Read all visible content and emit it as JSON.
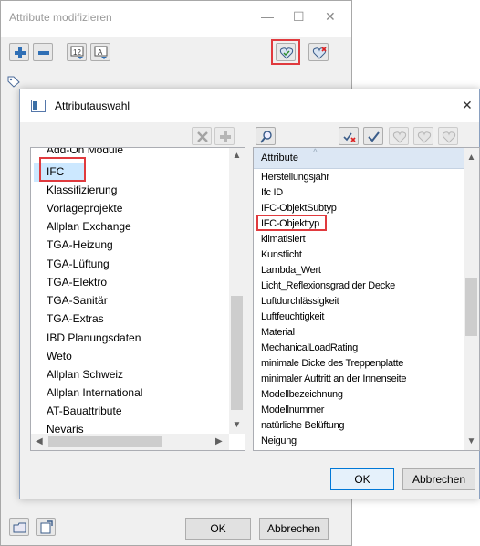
{
  "outer": {
    "title": "Attribute modifizieren",
    "ok": "OK",
    "cancel": "Abbrechen"
  },
  "window_controls": [
    "—",
    "☐",
    "✕"
  ],
  "inner": {
    "title": "Attributauswahl",
    "close": "✕",
    "ok": "OK",
    "cancel": "Abbrechen",
    "column_header": "Attribute"
  },
  "left_list": {
    "items": [
      "Add-On Module",
      "IFC",
      "Klassifizierung",
      "Vorlageprojekte",
      "Allplan Exchange",
      "TGA-Heizung",
      "TGA-Lüftung",
      "TGA-Elektro",
      "TGA-Sanitär",
      "TGA-Extras",
      "IBD Planungsdaten",
      "Weto",
      "Allplan Schweiz",
      "Allplan International",
      "AT-Bauattribute",
      "Nevaris"
    ],
    "selected": "IFC"
  },
  "right_list": {
    "items": [
      "Herstellungsjahr",
      "Ifc ID",
      "IFC-ObjektSubtyp",
      "IFC-Objekttyp",
      "klimatisiert",
      "Kunstlicht",
      "Lambda_Wert",
      "Licht_Reflexionsgrad der Decke",
      "Luftdurchlässigkeit",
      "Luftfeuchtigkeit",
      "Material",
      "MechanicalLoadRating",
      "minimale Dicke des Treppenplatte",
      "minimaler Auftritt an der Innenseite",
      "Modellbezeichnung",
      "Modellnummer",
      "natürliche Belüftung",
      "Neigung"
    ],
    "highlighted": "IFC-Objekttyp"
  },
  "icons": {
    "outer_toolbar": [
      "add-icon",
      "remove-icon",
      "number-format-icon",
      "text-format-icon",
      "favorite-add-icon",
      "favorite-delete-icon"
    ],
    "inner_toolbar": [
      "delete-icon",
      "add-icon",
      "search-icon",
      "uncheck-all-icon",
      "check-all-icon",
      "favorite-icon",
      "favorite-add-icon",
      "favorite-delete-icon"
    ],
    "bottom": [
      "open-folder-icon",
      "export-icon"
    ]
  },
  "colors": {
    "highlight_box": "#e03a3e",
    "selection": "#cce8ff",
    "default_button_border": "#0078d7"
  }
}
